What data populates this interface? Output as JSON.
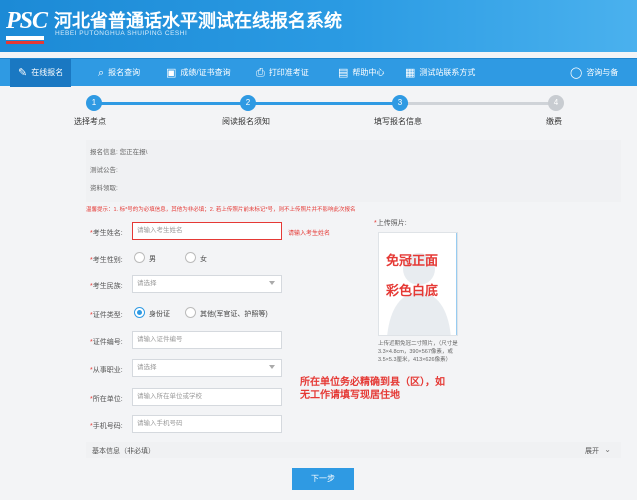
{
  "header": {
    "logo": "PSC",
    "title": "河北省普通话水平测试在线报名系统",
    "subtitle": "HEBEI PUTONGHUA SHUIPING CESHI"
  },
  "nav": {
    "items": [
      {
        "label": "在线报名",
        "icon": "edit-icon",
        "active": true
      },
      {
        "label": "报名查询",
        "icon": "search-icon"
      },
      {
        "label": "成绩/证书查询",
        "icon": "document-icon"
      },
      {
        "label": "打印准考证",
        "icon": "printer-icon"
      },
      {
        "label": "帮助中心",
        "icon": "help-icon"
      },
      {
        "label": "测试站联系方式",
        "icon": "contact-icon"
      }
    ],
    "right_label": "咨询与备"
  },
  "steps": [
    {
      "num": "1",
      "label": "选择考点",
      "done": true
    },
    {
      "num": "2",
      "label": "阅读报名须知",
      "done": true
    },
    {
      "num": "3",
      "label": "填写报名信息",
      "done": true
    },
    {
      "num": "4",
      "label": "缴费",
      "done": false
    }
  ],
  "info": {
    "line1": "报名信息: 您正在报\\",
    "line2": "测试公告:",
    "line3": "资料领取:"
  },
  "tip": "温馨提示：1. 标*号的为必填信息，其他为非必填；2. 若上传照片前未标记*号，则不上传照片并不影响此次报名",
  "form": {
    "name": {
      "label": "考生姓名:",
      "placeholder": "请输入考生姓名",
      "error": "请输入考生姓名"
    },
    "gender": {
      "label": "考生性别:",
      "options": [
        "男",
        "女"
      ]
    },
    "ethnicity": {
      "label": "考生民族:",
      "placeholder": "请选择"
    },
    "id_type": {
      "label": "证件类型:",
      "options": [
        "身份证",
        "其他(军官证、护照等)"
      ]
    },
    "id_number": {
      "label": "证件编号:",
      "placeholder": "请输入证件编号"
    },
    "occupation": {
      "label": "从事职业:",
      "placeholder": "请选择"
    },
    "employer": {
      "label": "所在单位:",
      "placeholder": "请输入所在单位或学校"
    },
    "phone": {
      "label": "手机号码:",
      "placeholder": "请输入手机号码"
    }
  },
  "photo": {
    "label": "上传照片:",
    "annot1": "免冠正面",
    "annot2": "彩色白底",
    "desc": "上传近期免冠二寸照片，（尺寸是3.3×4.8cm，390×567像素，或3.5×5.3厘米，413×626像素）"
  },
  "annotation_employer": "所在单位务必精确到县（区），如无工作请填写现居住地",
  "basic_info": {
    "label": "基本信息（非必填）",
    "toggle": "展开"
  },
  "next_button": "下一步",
  "colors": {
    "primary": "#2f9ae3",
    "error": "#e53935"
  }
}
